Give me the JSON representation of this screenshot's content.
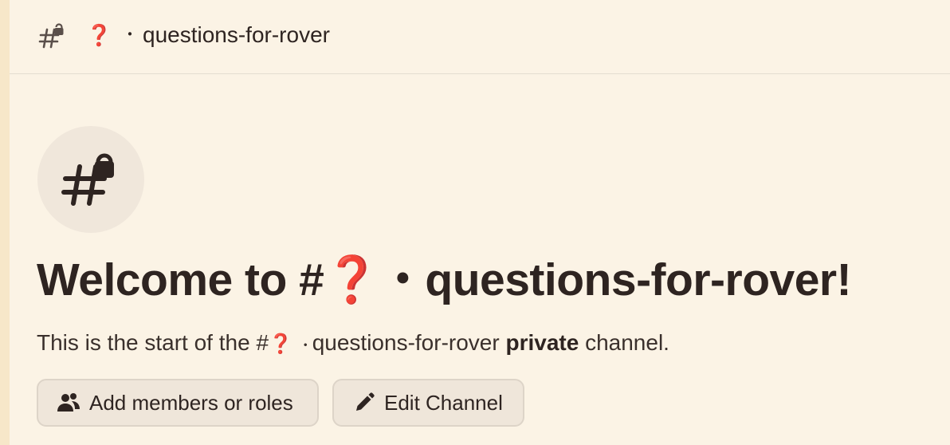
{
  "header": {
    "icon": "hashtag-lock-icon",
    "emoji": "❓",
    "separator": "・",
    "channel_name": "questions-for-rover"
  },
  "welcome": {
    "avatar_icon": "hashtag-lock-icon",
    "title_prefix": "Welcome to #",
    "title_emoji": "❓",
    "title_separator": "・",
    "title_name": "questions-for-rover!",
    "subtitle_prefix": "This is the start of the #",
    "subtitle_emoji": "❓",
    "subtitle_separator": "・",
    "subtitle_name": "questions-for-rover",
    "subtitle_bold": "private",
    "subtitle_suffix": "channel."
  },
  "actions": {
    "add_members_label": "Add members or roles",
    "add_members_icon": "people-icon",
    "edit_channel_label": "Edit Channel",
    "edit_channel_icon": "pencil-icon"
  },
  "colors": {
    "background": "#fbf3e5",
    "emoji_red": "#c8322a",
    "text": "#2e2421"
  }
}
